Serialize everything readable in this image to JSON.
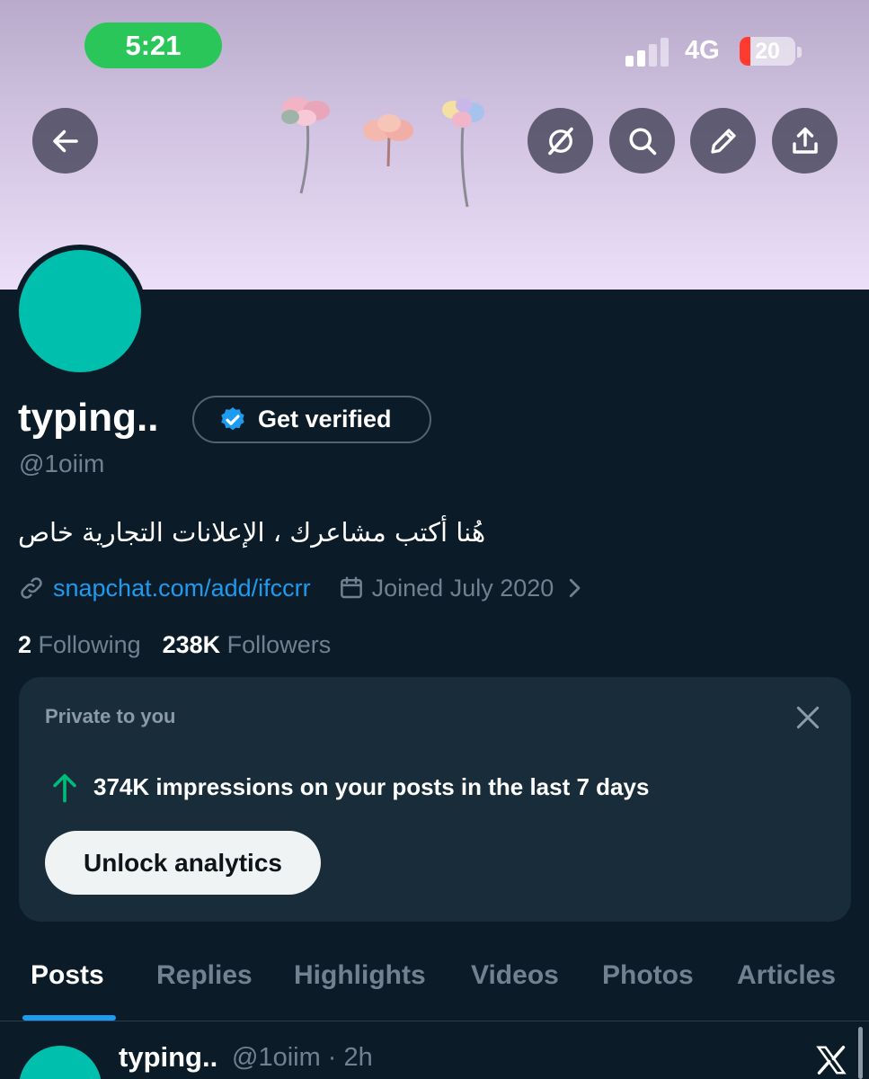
{
  "status_bar": {
    "time": "5:21",
    "network": "4G",
    "battery": "20",
    "battery_level": 0.2
  },
  "banner_buttons": [
    {
      "name": "back-button",
      "icon": "arrow-left-icon"
    },
    {
      "name": "grok-button",
      "icon": "grok-icon"
    },
    {
      "name": "search-button",
      "icon": "search-icon"
    },
    {
      "name": "edit-button",
      "icon": "pencil-icon"
    },
    {
      "name": "share-button",
      "icon": "share-icon"
    }
  ],
  "profile": {
    "display_name": "typing..",
    "verify_label": "Get verified",
    "handle": "@1oiim",
    "bio": "هُنا أكتب مشاعرك ، الإعلانات التجارية خاص",
    "link": "snapchat.com/add/ifccrr",
    "joined": "Joined July 2020",
    "following_count": "2",
    "following_label": "Following",
    "followers_count": "238K",
    "followers_label": "Followers",
    "avatar_color": "#00bfad"
  },
  "private_card": {
    "title": "Private to you",
    "stat": "374K impressions on your posts in the last 7 days",
    "button": "Unlock analytics"
  },
  "tabs": [
    {
      "label": "Posts",
      "active": true
    },
    {
      "label": "Replies",
      "active": false
    },
    {
      "label": "Highlights",
      "active": false
    },
    {
      "label": "Videos",
      "active": false
    },
    {
      "label": "Photos",
      "active": false
    },
    {
      "label": "Articles",
      "active": false
    }
  ],
  "post": {
    "name": "typing..",
    "handle_time": "@1oiim · 2h"
  },
  "colors": {
    "background": "#0b1c28",
    "accent": "#1d9bf0",
    "card": "#182c3a",
    "up_arrow": "#00ba7c"
  }
}
